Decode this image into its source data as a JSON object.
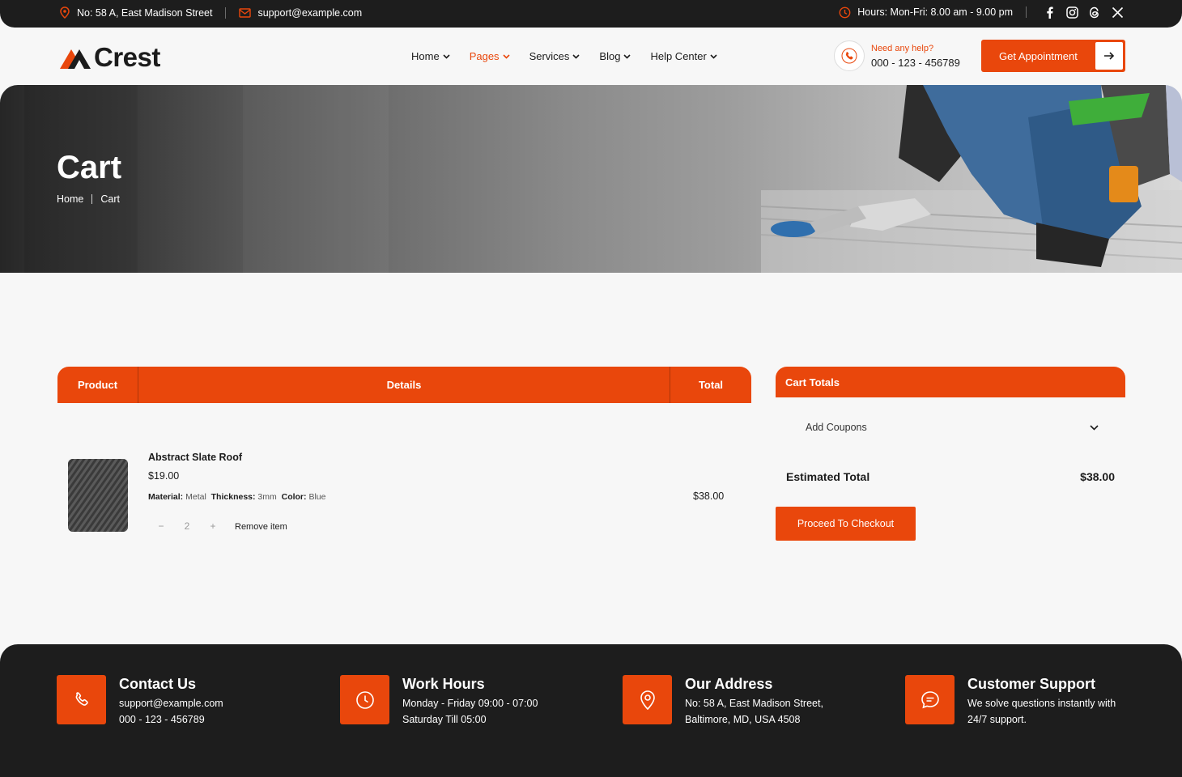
{
  "topbar": {
    "address": "No: 58 A, East Madison Street",
    "email": "support@example.com",
    "hours": "Hours: Mon-Fri: 8.00 am - 9.00 pm"
  },
  "header": {
    "logo_text": "Crest",
    "nav": [
      {
        "label": "Home",
        "active": false
      },
      {
        "label": "Pages",
        "active": true
      },
      {
        "label": "Services",
        "active": false
      },
      {
        "label": "Blog",
        "active": false
      },
      {
        "label": "Help Center",
        "active": false
      }
    ],
    "help_label": "Need any help?",
    "help_phone": "000 - 123 - 456789",
    "appointment_label": "Get Appointment"
  },
  "hero": {
    "title": "Cart",
    "breadcrumb": [
      "Home",
      "Cart"
    ]
  },
  "cart": {
    "headers": {
      "product": "Product",
      "details": "Details",
      "total": "Total"
    },
    "item": {
      "name": "Abstract Slate Roof",
      "price": "$19.00",
      "material_label": "Material:",
      "material": "Metal",
      "thickness_label": "Thickness:",
      "thickness": "3mm",
      "color_label": "Color:",
      "color": "Blue",
      "qty_minus": "−",
      "quantity": "2",
      "qty_plus": "+",
      "remove_label": "Remove item",
      "line_total": "$38.00"
    }
  },
  "totals": {
    "title": "Cart Totals",
    "coupon_label": "Add Coupons",
    "estimated_label": "Estimated Total",
    "estimated_value": "$38.00",
    "checkout_label": "Proceed To Checkout"
  },
  "footer": {
    "cards": [
      {
        "icon": "phone-icon",
        "title": "Contact Us",
        "lines": [
          "support@example.com",
          "000 - 123 - 456789"
        ]
      },
      {
        "icon": "clock-icon",
        "title": "Work Hours",
        "lines": [
          "Monday - Friday 09:00 - 07:00",
          "Saturday Till 05:00"
        ]
      },
      {
        "icon": "location-pin-icon",
        "title": "Our Address",
        "lines": [
          "No: 58 A, East Madison Street,",
          "Baltimore, MD, USA 4508"
        ]
      },
      {
        "icon": "chat-bubble-icon",
        "title": "Customer Support",
        "lines": [
          "We solve questions instantly with",
          "24/7 support."
        ]
      }
    ]
  },
  "colors": {
    "accent": "#e9470c",
    "dark": "#1d1d1d",
    "background": "#f7f7f7"
  }
}
